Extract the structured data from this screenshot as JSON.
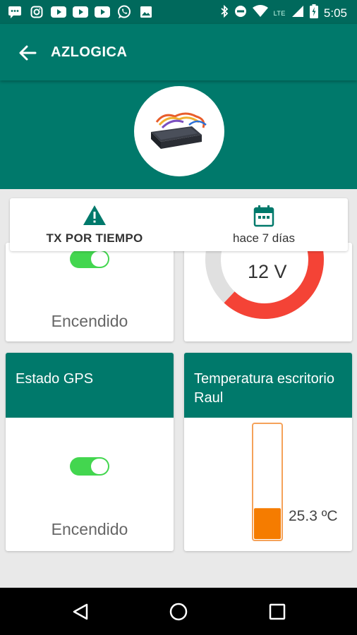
{
  "status_bar": {
    "notification_icons": [
      "chat-icon",
      "instagram-icon",
      "youtube-icon",
      "youtube-icon",
      "youtube-icon",
      "whatsapp-icon",
      "image-icon"
    ],
    "network_label": "LTE",
    "time": "5:05"
  },
  "app_bar": {
    "title": "AZLOGICA"
  },
  "info": {
    "left_label": "TX POR TIEMPO",
    "right_label": "hace 7 días"
  },
  "tiles": {
    "top_left_state": "Encendido",
    "top_right_value": "12 V",
    "gps_title": "Estado GPS",
    "gps_state": "Encendido",
    "temp_title": "Temperatura escritorio Raul",
    "temp_value": "25.3 ºC"
  },
  "colors": {
    "primary": "#00796b",
    "primary_dark": "#00695c",
    "toggle_on": "#43d64f",
    "gauge_red": "#f44336",
    "gauge_track": "#e0e0e0",
    "thermo_fill": "#f57c00"
  },
  "values": {
    "gauge_fill_fraction": 0.62,
    "thermo_fill_fraction": 0.27
  }
}
